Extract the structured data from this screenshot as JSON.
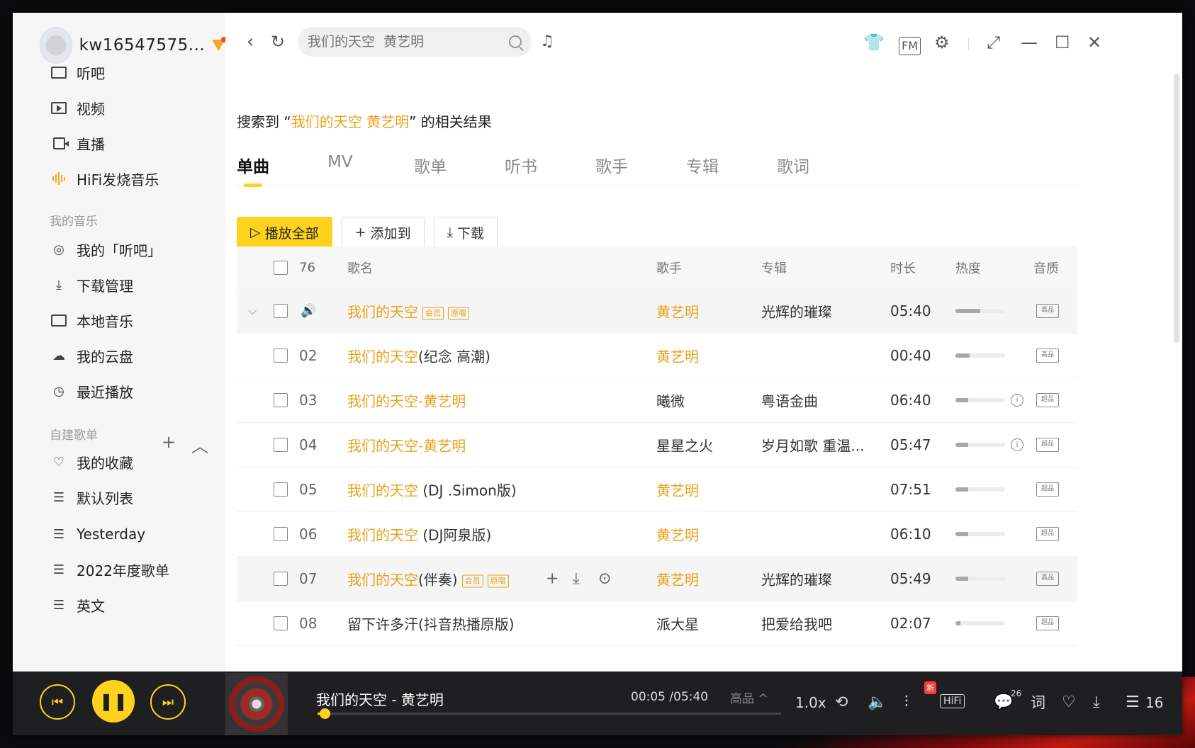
{
  "user": {
    "name": "kw16547575..."
  },
  "sidebar": {
    "top_items": [
      {
        "label": "听吧",
        "icon": "radio-icon"
      },
      {
        "label": "视频",
        "icon": "video-icon"
      },
      {
        "label": "直播",
        "icon": "live-icon"
      },
      {
        "label": "HiFi发烧音乐",
        "icon": "hifi-wave-icon"
      }
    ],
    "my_music_label": "我的音乐",
    "my_music_items": [
      {
        "label": "我的「听吧」",
        "icon": "listen-icon"
      },
      {
        "label": "下载管理",
        "icon": "download-icon"
      },
      {
        "label": "本地音乐",
        "icon": "monitor-icon"
      },
      {
        "label": "我的云盘",
        "icon": "cloud-icon"
      },
      {
        "label": "最近播放",
        "icon": "clock-icon"
      }
    ],
    "playlists_label": "自建歌单",
    "playlists": [
      {
        "label": "我的收藏",
        "icon": "heart-icon"
      },
      {
        "label": "默认列表",
        "icon": "playlist-icon"
      },
      {
        "label": "Yesterday",
        "icon": "playlist-icon"
      },
      {
        "label": "2022年度歌单",
        "icon": "playlist-icon"
      },
      {
        "label": "英文",
        "icon": "playlist-icon"
      }
    ]
  },
  "search": {
    "placeholder": "我们的天空  黄艺明"
  },
  "result": {
    "prefix": "搜索到 “",
    "query": "我们的天空 黄艺明",
    "suffix": "” 的相关结果"
  },
  "tabs": [
    "单曲",
    "MV",
    "歌单",
    "听书",
    "歌手",
    "专辑",
    "歌词"
  ],
  "actions": {
    "play_all": "播放全部",
    "add_to": "添加到",
    "download": "下载"
  },
  "table": {
    "count": "76",
    "headers": {
      "title": "歌名",
      "artist": "歌手",
      "album": "专辑",
      "duration": "时长",
      "heat": "热度",
      "quality": "音质"
    },
    "rows": [
      {
        "num": "",
        "title_main": "我们的天空",
        "title_rest": "",
        "tags": [
          "会员",
          "原唱"
        ],
        "artist": "黄艺明",
        "artist_hl": true,
        "album": "光辉的璀璨",
        "duration": "05:40",
        "heat": 0.5,
        "quality": "高品",
        "playing": true,
        "info": false
      },
      {
        "num": "02",
        "title_main": "我们的天空",
        "title_rest": "(纪念 高潮)",
        "tags": [],
        "artist": "黄艺明",
        "artist_hl": true,
        "album": "",
        "duration": "00:40",
        "heat": 0.28,
        "quality": "高品",
        "playing": false,
        "info": false
      },
      {
        "num": "03",
        "title_main": "我们的天空-黄艺明",
        "title_rest": "",
        "tags": [],
        "artist": "曦微",
        "artist_hl": false,
        "album": "粤语金曲",
        "duration": "06:40",
        "heat": 0.26,
        "quality": "超品",
        "playing": false,
        "info": true
      },
      {
        "num": "04",
        "title_main": "我们的天空-黄艺明",
        "title_rest": "",
        "tags": [],
        "artist": "星星之火",
        "artist_hl": false,
        "album": "岁月如歌 重温...",
        "duration": "05:47",
        "heat": 0.26,
        "quality": "超品",
        "playing": false,
        "info": true
      },
      {
        "num": "05",
        "title_main": "我们的天空",
        "title_rest": " (DJ .Simon版)",
        "tags": [],
        "artist": "黄艺明",
        "artist_hl": true,
        "album": "",
        "duration": "07:51",
        "heat": 0.26,
        "quality": "超品",
        "playing": false,
        "info": false
      },
      {
        "num": "06",
        "title_main": "我们的天空",
        "title_rest": " (DJ阿泉版)",
        "tags": [],
        "artist": "黄艺明",
        "artist_hl": true,
        "album": "",
        "duration": "06:10",
        "heat": 0.26,
        "quality": "超品",
        "playing": false,
        "info": false
      },
      {
        "num": "07",
        "title_main": "我们的天空",
        "title_rest": "(伴奏)",
        "tags": [
          "会员",
          "原唱"
        ],
        "artist": "黄艺明",
        "artist_hl": true,
        "album": "光辉的璀璨",
        "duration": "05:49",
        "heat": 0.26,
        "quality": "高品",
        "playing": false,
        "info": false
      },
      {
        "num": "08",
        "title_main": "",
        "title_rest": "留下许多汗(抖音热播原版)",
        "tags": [],
        "artist": "派大星",
        "artist_hl": false,
        "album": "把爱给我吧",
        "duration": "02:07",
        "heat": 0.1,
        "quality": "超品",
        "playing": false,
        "info": false
      }
    ]
  },
  "player": {
    "title": "我们的天空 - 黄艺明",
    "time": "00:05 /05:40",
    "quality": "高品 ^",
    "progress": 0.015,
    "speed": "1.0x",
    "new_badge": "新",
    "hifi": "HiFi",
    "comments": "26",
    "lyric": "词",
    "queue_count": "16"
  },
  "colors": {
    "accent": "#ffd21e",
    "highlight": "#e8a21b",
    "player_bg": "#1f1f22"
  }
}
